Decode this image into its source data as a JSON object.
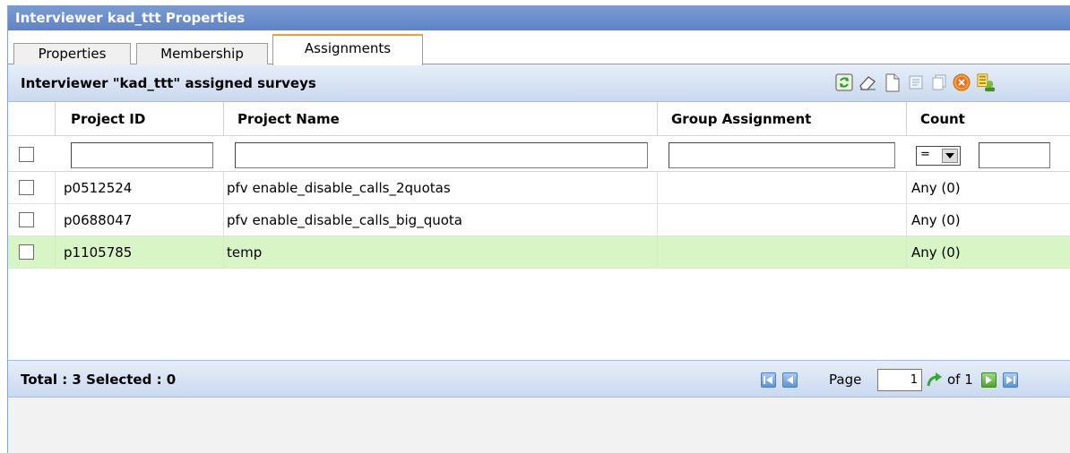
{
  "window": {
    "title": "Interviewer kad_ttt Properties"
  },
  "tabs": [
    {
      "label": "Properties"
    },
    {
      "label": "Membership"
    },
    {
      "label": "Assignments",
      "active": true
    }
  ],
  "toolbar": {
    "title": "Interviewer \"kad_ttt\" assigned surveys",
    "icons": [
      "refresh-icon",
      "eraser-icon",
      "new-document-icon",
      "properties-icon",
      "copy-icon",
      "cancel-icon",
      "assign-icon"
    ]
  },
  "grid": {
    "columns": [
      "Project ID",
      "Project Name",
      "Group Assignment",
      "Count"
    ],
    "filter": {
      "count_operator": "="
    },
    "rows": [
      {
        "project_id": "p0512524",
        "project_name": "pfv enable_disable_calls_2quotas",
        "group_assignment": "",
        "count": "Any (0)",
        "highlighted": false
      },
      {
        "project_id": "p0688047",
        "project_name": "pfv enable_disable_calls_big_quota",
        "group_assignment": "",
        "count": "Any (0)",
        "highlighted": false
      },
      {
        "project_id": "p1105785",
        "project_name": "temp",
        "group_assignment": "",
        "count": "Any (0)",
        "highlighted": true
      }
    ]
  },
  "footer": {
    "total_text": "Total : 3 Selected : 0",
    "page_label": "Page",
    "page_value": "1",
    "of_label": "of 1"
  },
  "colors": {
    "titlebar": "#6a8fcc",
    "highlight_row": "#d8f5c5",
    "active_tab_accent": "#f0a030"
  }
}
